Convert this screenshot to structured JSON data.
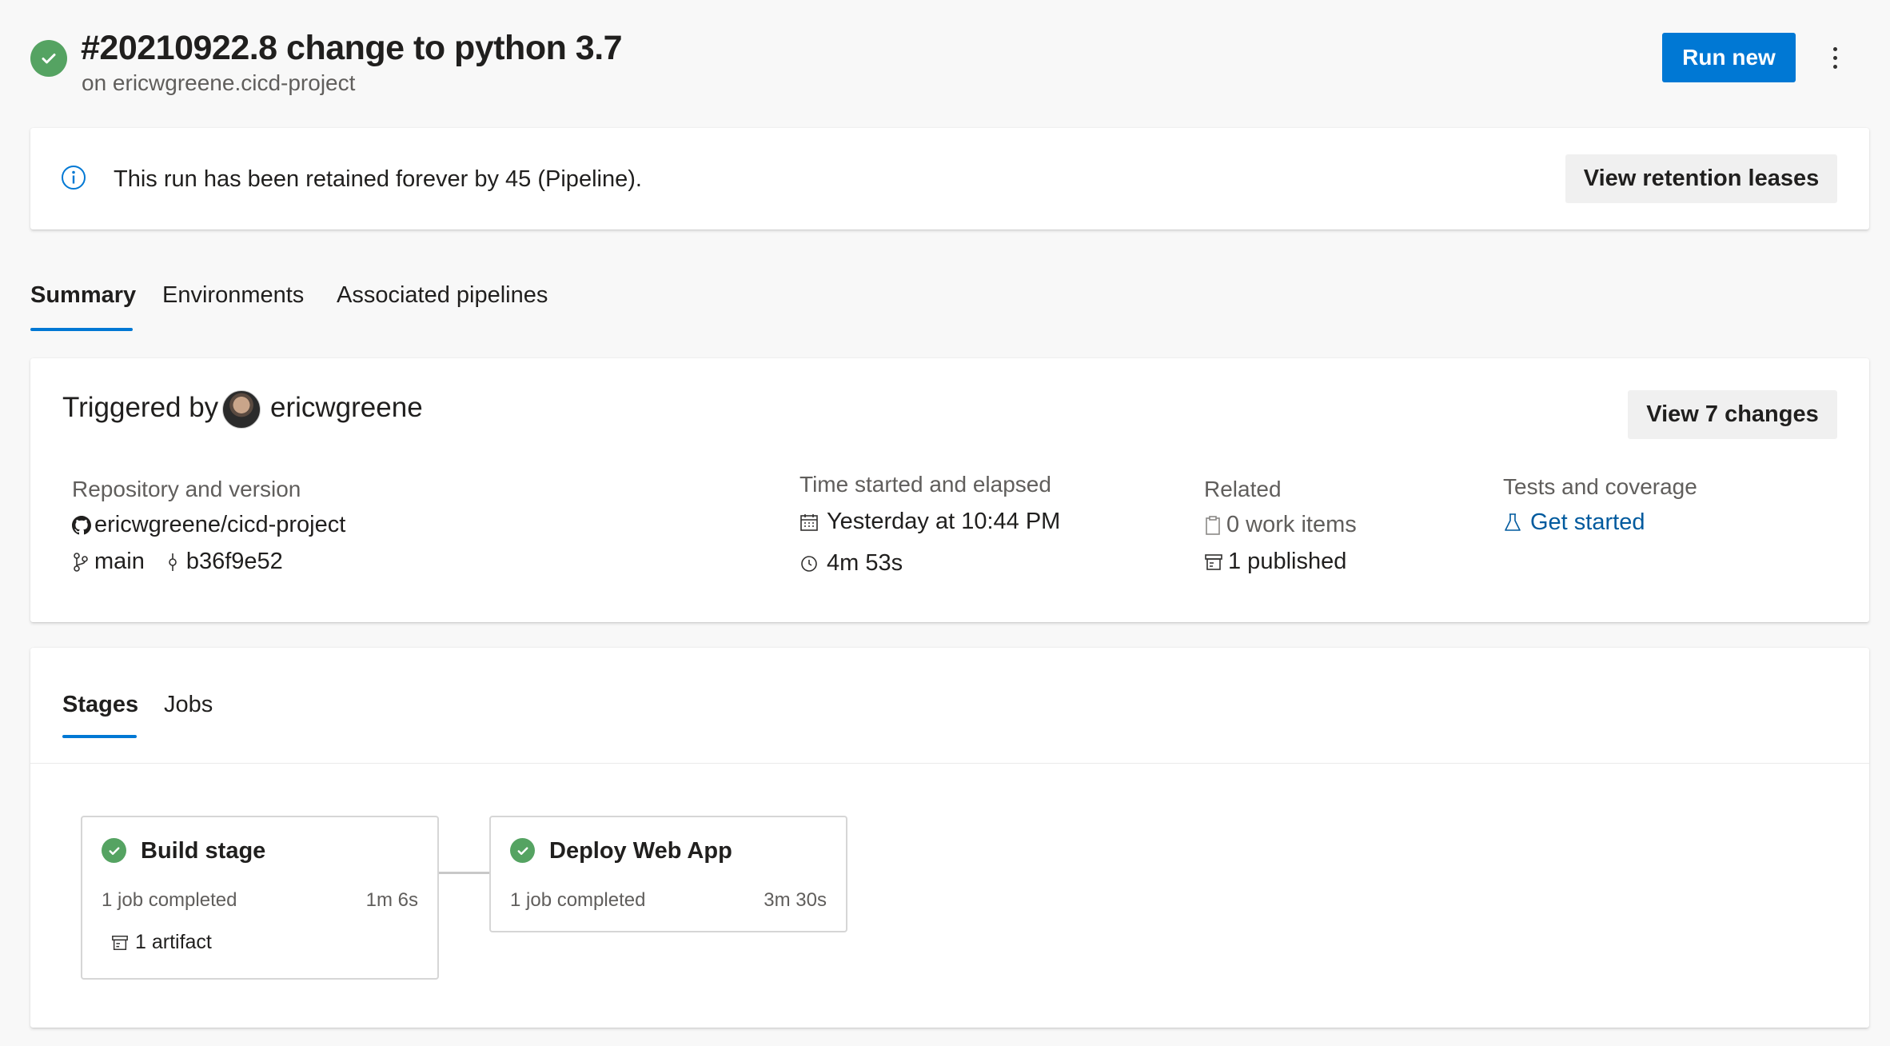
{
  "header": {
    "title": "#20210922.8 change to python 3.7",
    "subtitle": "on ericwgreene.cicd-project",
    "run_new_label": "Run new",
    "status": "succeeded"
  },
  "banner": {
    "message": "This run has been retained forever by 45 (Pipeline).",
    "action_label": "View retention leases"
  },
  "tabs": [
    {
      "label": "Summary",
      "selected": true
    },
    {
      "label": "Environments",
      "selected": false
    },
    {
      "label": "Associated pipelines",
      "selected": false
    }
  ],
  "summary": {
    "triggered_by_label": "Triggered by",
    "user_name": "ericwgreene",
    "view_changes_label": "View 7 changes",
    "repo": {
      "label": "Repository and version",
      "name": "ericwgreene/cicd-project",
      "branch": "main",
      "commit": "b36f9e52"
    },
    "time": {
      "label": "Time started and elapsed",
      "started": "Yesterday at 10:44 PM",
      "elapsed": "4m 53s"
    },
    "related": {
      "label": "Related",
      "work_items": "0 work items",
      "published": "1 published"
    },
    "tests": {
      "label": "Tests and coverage",
      "link": "Get started"
    }
  },
  "stages_panel": {
    "tabs": [
      {
        "label": "Stages",
        "selected": true
      },
      {
        "label": "Jobs",
        "selected": false
      }
    ],
    "stages": [
      {
        "name": "Build stage",
        "jobs": "1 job completed",
        "duration": "1m 6s",
        "artifact": "1 artifact"
      },
      {
        "name": "Deploy Web App",
        "jobs": "1 job completed",
        "duration": "3m 30s"
      }
    ]
  },
  "colors": {
    "accent": "#0078d4",
    "success": "#55a362",
    "link": "#005a9e"
  }
}
